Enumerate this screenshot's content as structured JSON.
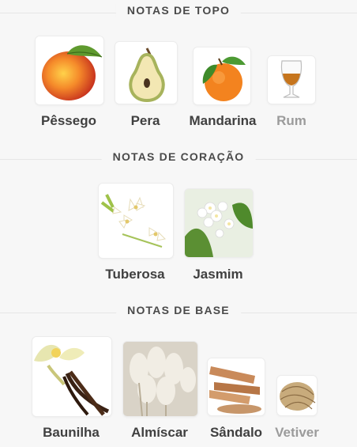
{
  "sections": [
    {
      "title": "NOTAS DE TOPO",
      "notes": [
        {
          "label": "Pêssego",
          "icon": "peach-icon"
        },
        {
          "label": "Pera",
          "icon": "pear-icon"
        },
        {
          "label": "Mandarina",
          "icon": "mandarin-icon"
        },
        {
          "label": "Rum",
          "icon": "rum-glass-icon"
        }
      ]
    },
    {
      "title": "NOTAS DE CORAÇÃO",
      "notes": [
        {
          "label": "Tuberosa",
          "icon": "tuberose-flower-icon"
        },
        {
          "label": "Jasmim",
          "icon": "jasmine-flower-icon"
        }
      ]
    },
    {
      "title": "NOTAS DE BASE",
      "notes": [
        {
          "label": "Baunilha",
          "icon": "vanilla-icon"
        },
        {
          "label": "Almíscar",
          "icon": "musk-icon"
        },
        {
          "label": "Sândalo",
          "icon": "sandalwood-icon"
        },
        {
          "label": "Vetiver",
          "icon": "vetiver-icon"
        }
      ]
    }
  ]
}
